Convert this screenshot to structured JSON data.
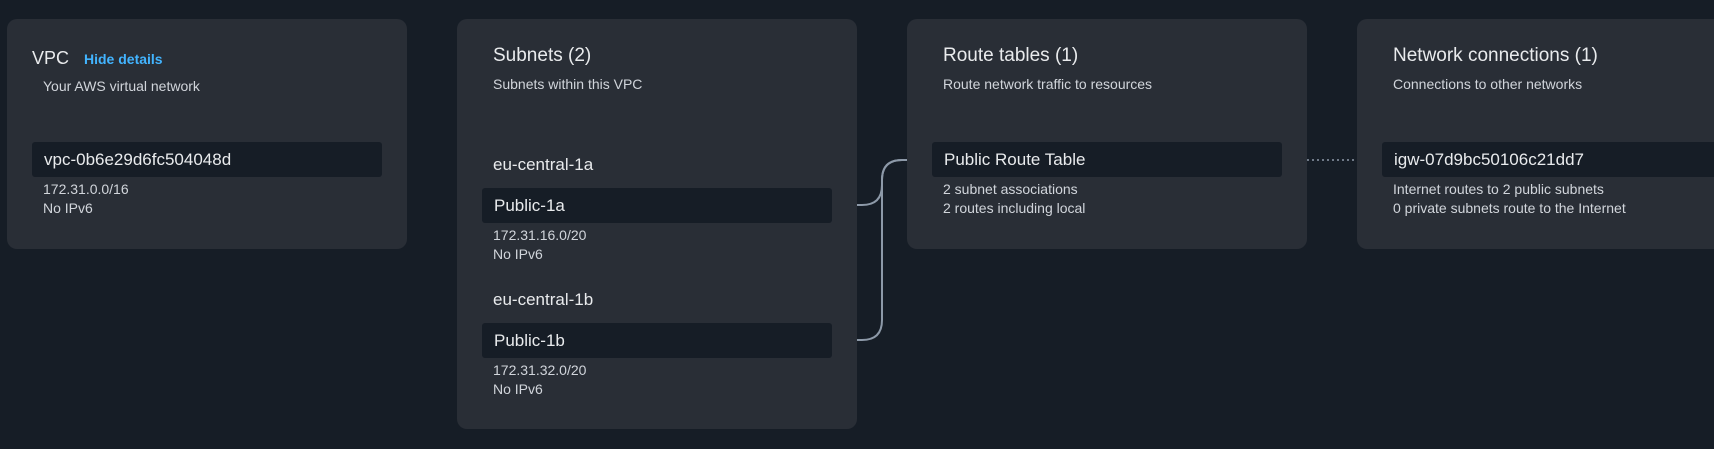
{
  "vpc": {
    "title": "VPC",
    "toggle_label": "Hide details",
    "subtitle": "Your AWS virtual network",
    "id": "vpc-0b6e29d6fc504048d",
    "cidr": "172.31.0.0/16",
    "ipv6": "No IPv6"
  },
  "subnets": {
    "title": "Subnets (2)",
    "subtitle": "Subnets within this VPC",
    "groups": [
      {
        "az": "eu-central-1a",
        "name": "Public-1a",
        "cidr": "172.31.16.0/20",
        "ipv6": "No IPv6"
      },
      {
        "az": "eu-central-1b",
        "name": "Public-1b",
        "cidr": "172.31.32.0/20",
        "ipv6": "No IPv6"
      }
    ]
  },
  "route_tables": {
    "title": "Route tables (1)",
    "subtitle": "Route network traffic to resources",
    "items": [
      {
        "name": "Public Route Table",
        "associations": "2 subnet associations",
        "routes": "2 routes including local"
      }
    ]
  },
  "network_connections": {
    "title": "Network connections (1)",
    "subtitle": "Connections to other networks",
    "items": [
      {
        "id": "igw-07d9bc50106c21dd7",
        "public_routes": "Internet routes to 2 public subnets",
        "private_routes": "0 private subnets route to the Internet"
      }
    ]
  },
  "colors": {
    "background": "#161d26",
    "card": "#292e36",
    "pill": "#161d26",
    "link": "#42b4ff",
    "connector": "#8d99a8"
  }
}
